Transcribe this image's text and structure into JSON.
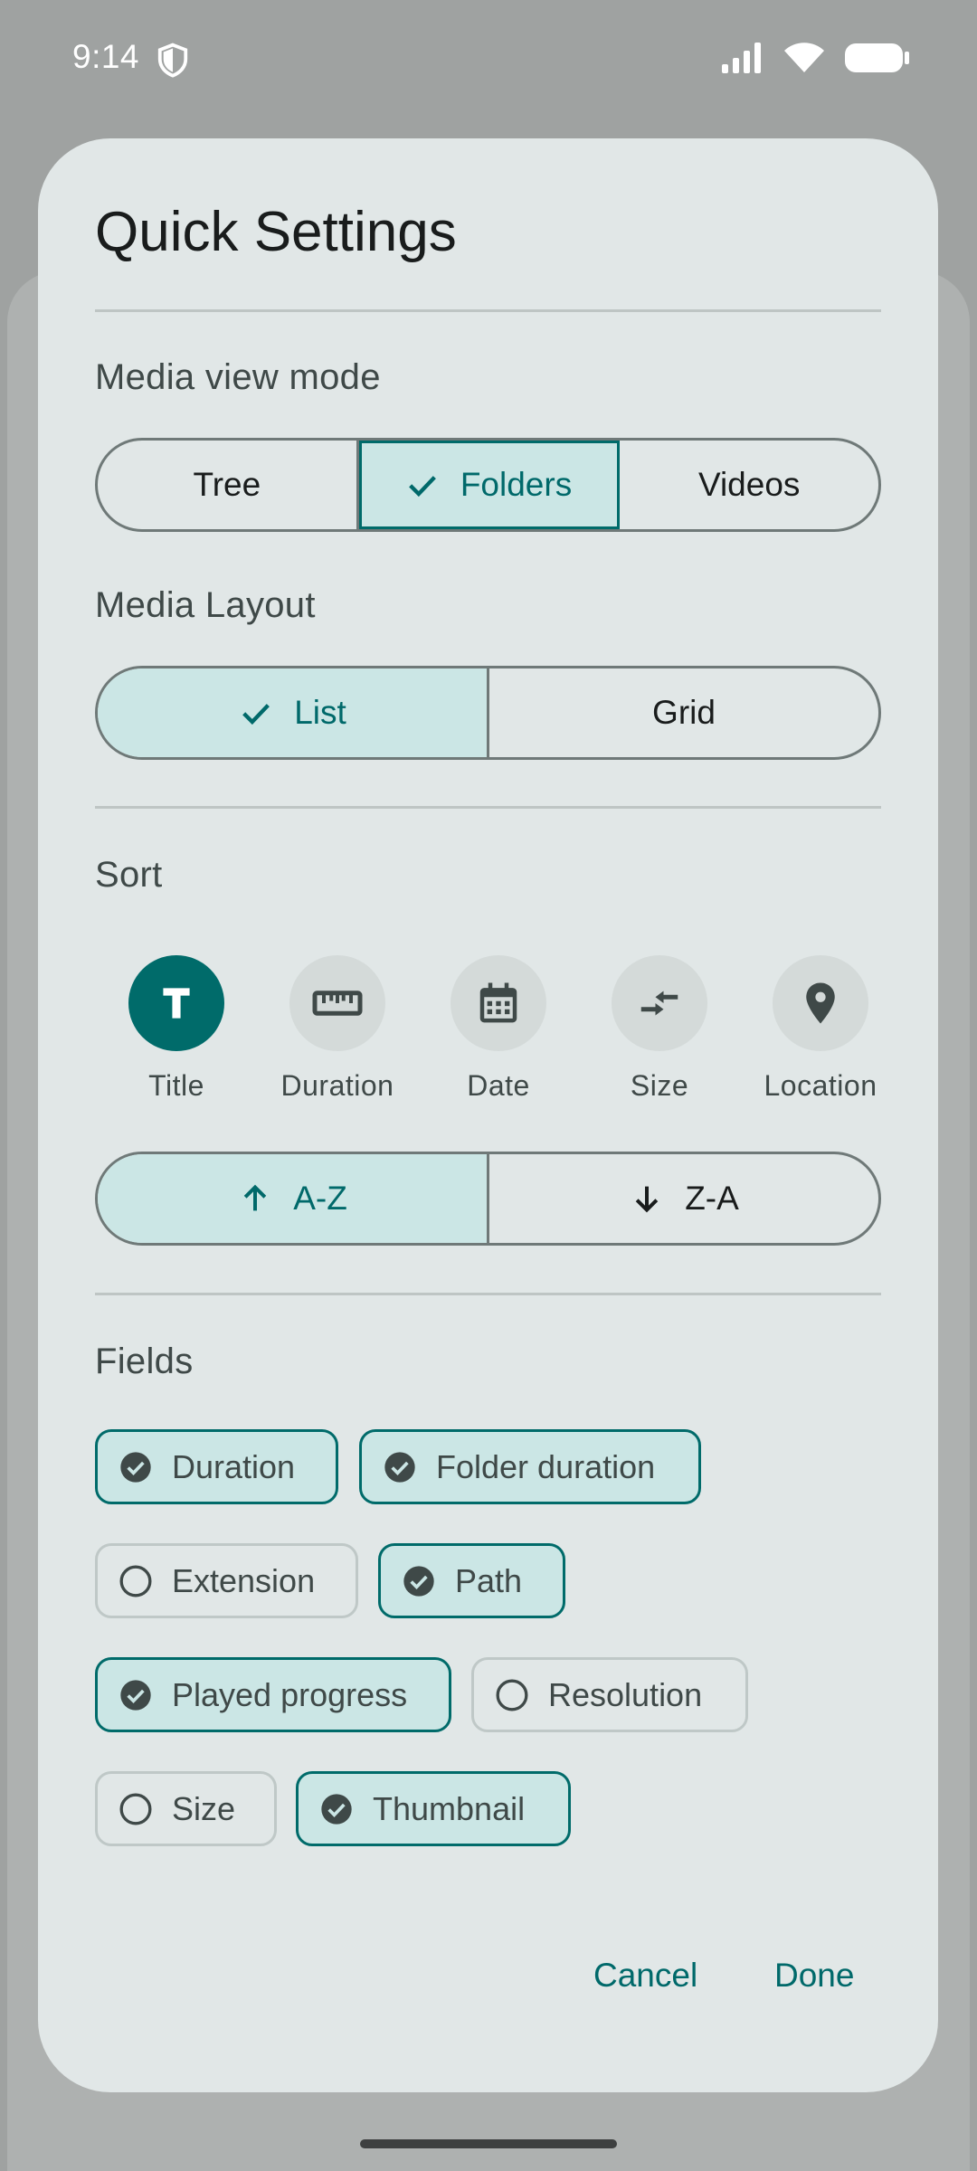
{
  "status_bar": {
    "time": "9:14"
  },
  "dialog": {
    "title": "Quick Settings",
    "view_mode": {
      "label": "Media view mode",
      "options": [
        "Tree",
        "Folders",
        "Videos"
      ],
      "selected": "Folders"
    },
    "layout": {
      "label": "Media Layout",
      "options": [
        "List",
        "Grid"
      ],
      "selected": "List"
    },
    "sort": {
      "label": "Sort",
      "options": [
        {
          "label": "Title",
          "icon": "title-t-icon",
          "selected": true
        },
        {
          "label": "Duration",
          "icon": "ruler-icon",
          "selected": false
        },
        {
          "label": "Date",
          "icon": "calendar-icon",
          "selected": false
        },
        {
          "label": "Size",
          "icon": "compress-arrows-icon",
          "selected": false
        },
        {
          "label": "Location",
          "icon": "location-pin-icon",
          "selected": false
        }
      ],
      "order": [
        "A-Z",
        "Z-A"
      ],
      "order_selected": "A-Z"
    },
    "fields": {
      "label": "Fields",
      "chips": [
        {
          "label": "Duration",
          "checked": true
        },
        {
          "label": "Folder duration",
          "checked": true
        },
        {
          "label": "Extension",
          "checked": false
        },
        {
          "label": "Path",
          "checked": true
        },
        {
          "label": "Played progress",
          "checked": true
        },
        {
          "label": "Resolution",
          "checked": false
        },
        {
          "label": "Size",
          "checked": false
        },
        {
          "label": "Thumbnail",
          "checked": true
        }
      ]
    },
    "actions": {
      "cancel": "Cancel",
      "done": "Done"
    }
  },
  "colors": {
    "accent": "#006b6a",
    "selected_fill": "#cbe6e5",
    "dialog_bg": "#e1e7e7",
    "scrim": "#9fa2a1"
  }
}
